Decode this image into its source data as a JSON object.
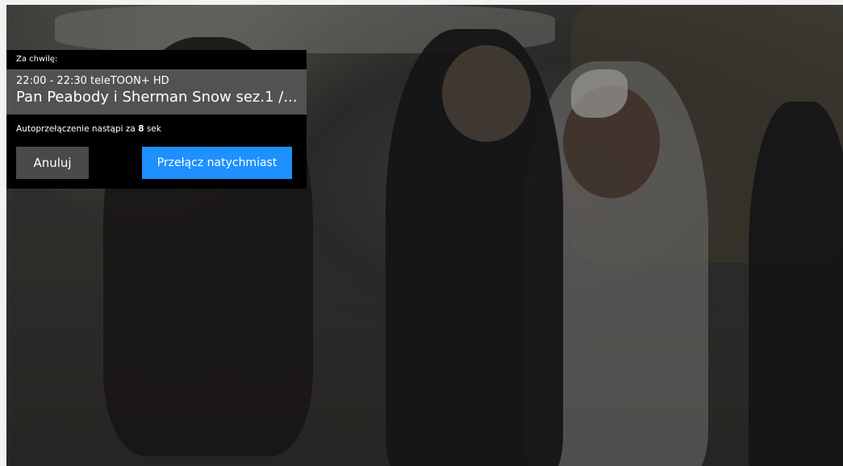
{
  "overlay": {
    "header": "Za chwilę:",
    "program": {
      "time_channel": "22:00 - 22:30 teleTOON+ HD",
      "title": "Pan Peabody i Sherman Snow sez.1 /..."
    },
    "autoswitch": {
      "prefix": "Autoprzełączenie nastąpi za ",
      "seconds": "8",
      "suffix": " sek"
    },
    "buttons": {
      "cancel_label": "Anuluj",
      "switch_label": "Przełącz natychmiast"
    }
  },
  "colors": {
    "panel_bg": "#000000",
    "program_bg": "#545250",
    "cancel_bg": "#4a4a48",
    "accent": "#1e90ff"
  }
}
